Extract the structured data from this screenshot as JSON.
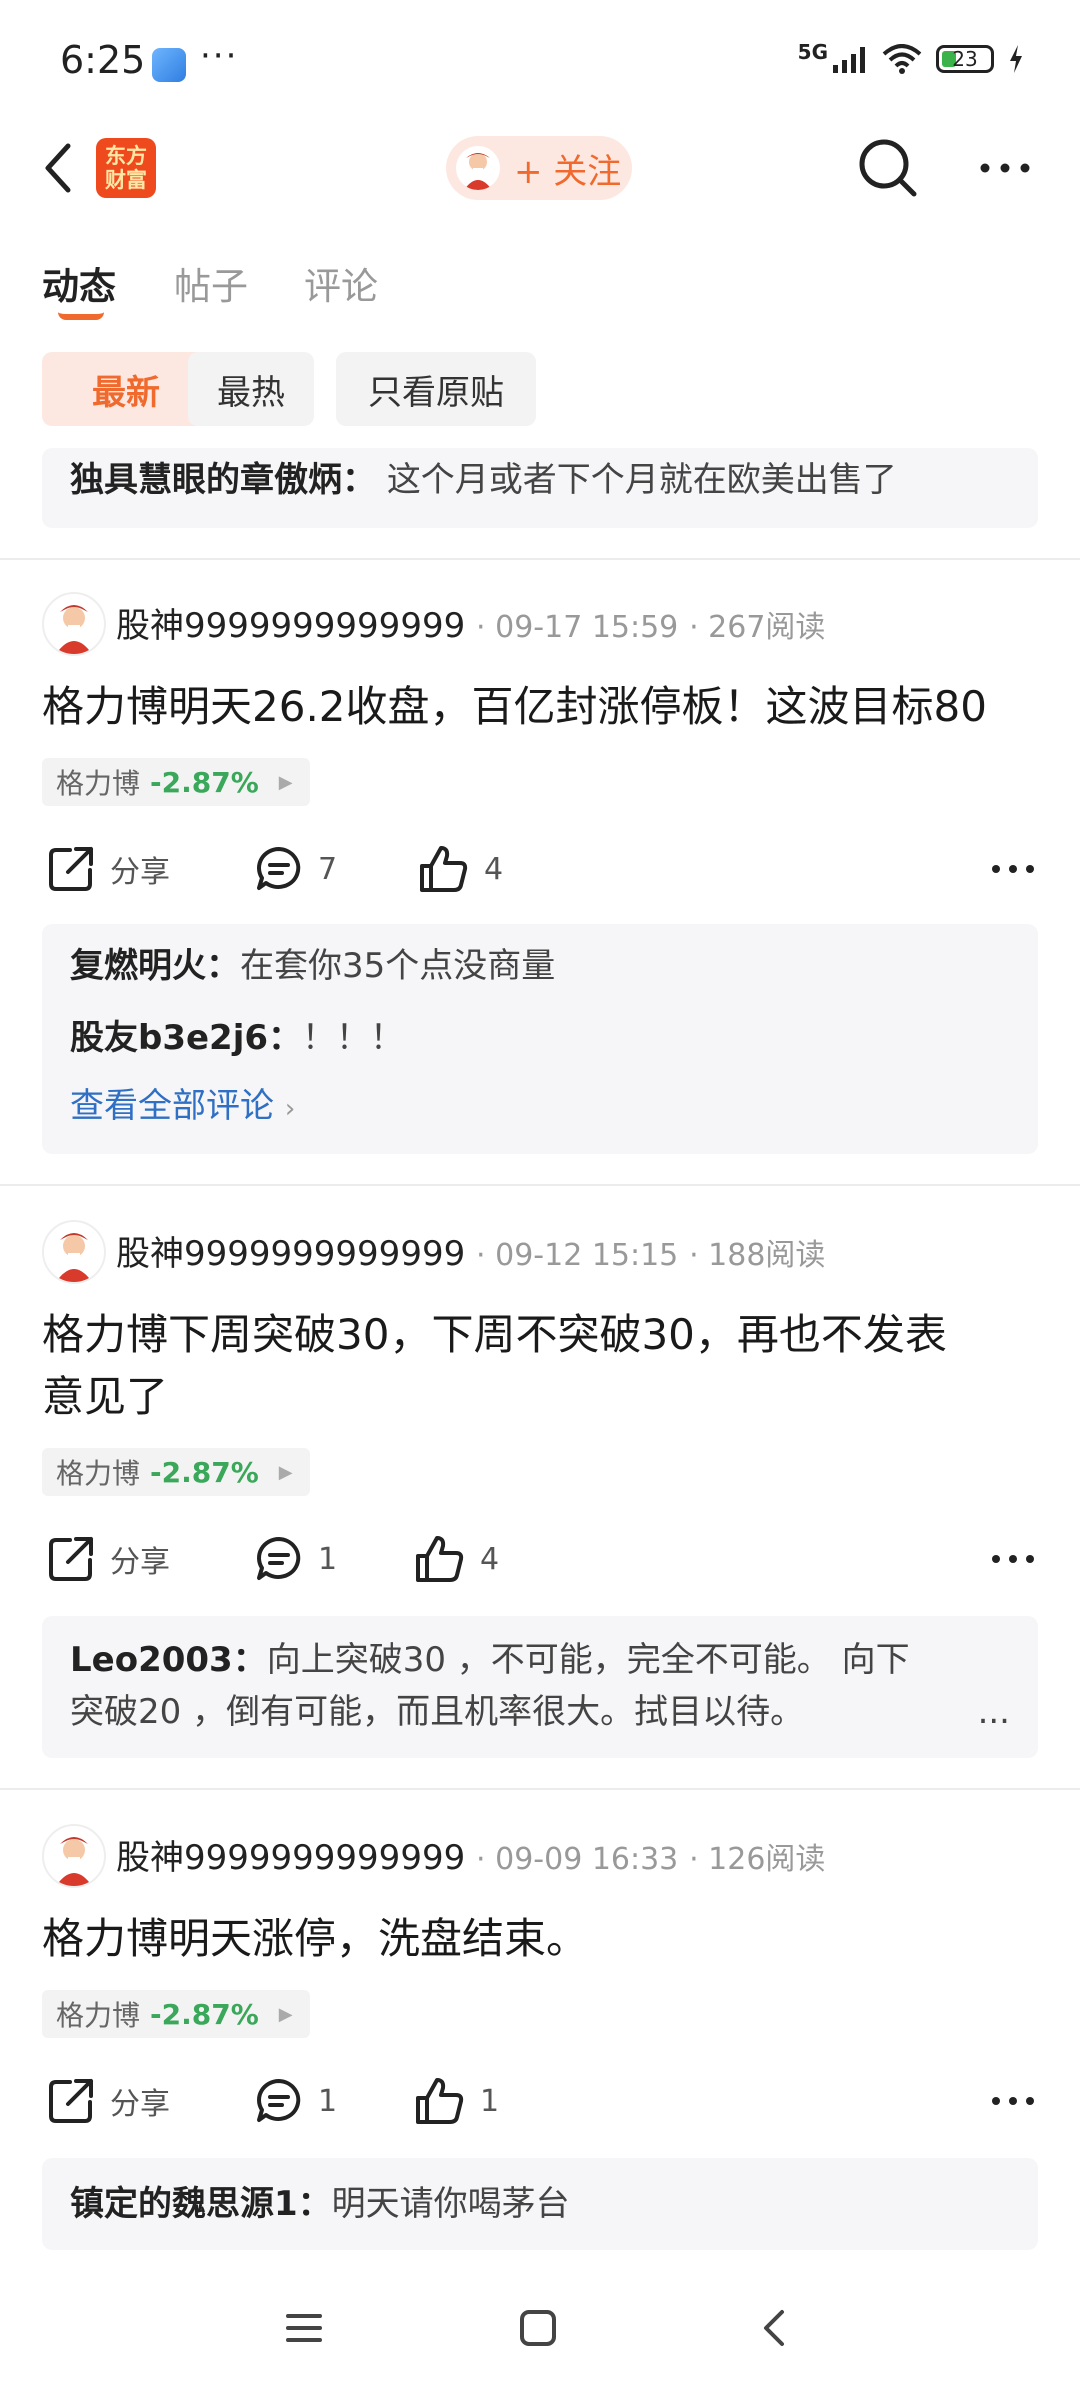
{
  "status": {
    "time": "6:25",
    "more": "···",
    "network": "5G",
    "battery": "23"
  },
  "header": {
    "logo_line1": "东方",
    "logo_line2": "财富",
    "follow_label": "+ 关注"
  },
  "tabs": [
    "动态",
    "帖子",
    "评论"
  ],
  "filters": [
    "最新",
    "最热",
    "只看原贴"
  ],
  "top_comment": {
    "author": "独具慧眼的章傲炳",
    "text": "这个月或者下个月就在欧美出售了"
  },
  "posts": [
    {
      "author": "股神9999999999999",
      "time": "09-17 15:59",
      "reads": "267阅读",
      "title": "格力博明天26.2收盘，百亿封涨停板！这波目标80",
      "stock": {
        "name": "格力博",
        "change": "-2.87%"
      },
      "share_label": "分享",
      "comments": "7",
      "likes": "4",
      "replies": [
        {
          "author": "复燃明火",
          "text": "在套你35个点没商量"
        },
        {
          "author": "股友b3e2j6",
          "text": "！！！"
        }
      ],
      "view_all": "查看全部评论"
    },
    {
      "author": "股神9999999999999",
      "time": "09-12 15:15",
      "reads": "188阅读",
      "title_line1": "格力博下周突破30，下周不突破30，再也不发表",
      "title_line2": "意见了",
      "stock": {
        "name": "格力博",
        "change": "-2.87%"
      },
      "share_label": "分享",
      "comments": "1",
      "likes": "4",
      "reply": {
        "author": "Leo2003",
        "line1": "向上突破30 ，不可能，完全不可能。 向下",
        "line2": "突破20 ，倒有可能，而且机率很大。拭目以待。",
        "ellipsis": "..."
      }
    },
    {
      "author": "股神9999999999999",
      "time": "09-09 16:33",
      "reads": "126阅读",
      "title": "格力博明天涨停，洗盘结束。",
      "stock": {
        "name": "格力博",
        "change": "-2.87%"
      },
      "share_label": "分享",
      "comments": "1",
      "likes": "1",
      "reply": {
        "author": "镇定的魏思源1",
        "text": "明天请你喝茅台"
      }
    }
  ],
  "colors": {
    "accent": "#f06a2e",
    "down": "#3aa75a",
    "link": "#2f6fc4"
  }
}
